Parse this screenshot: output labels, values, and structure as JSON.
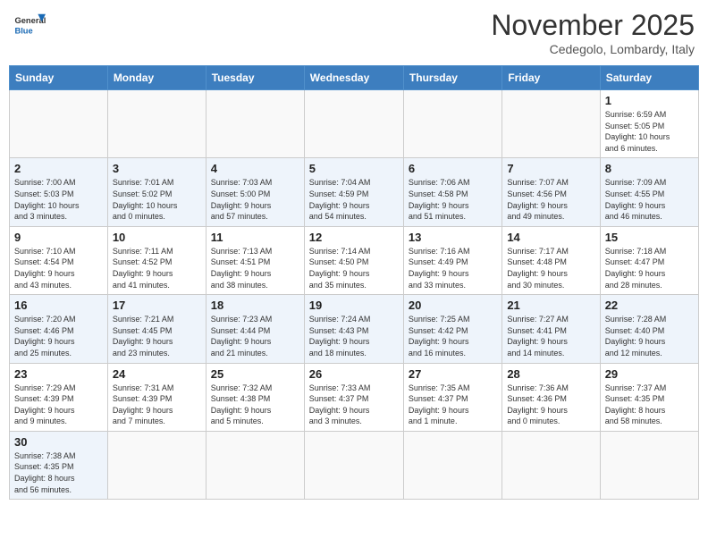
{
  "header": {
    "logo_general": "General",
    "logo_blue": "Blue",
    "month": "November 2025",
    "location": "Cedegolo, Lombardy, Italy"
  },
  "weekdays": [
    "Sunday",
    "Monday",
    "Tuesday",
    "Wednesday",
    "Thursday",
    "Friday",
    "Saturday"
  ],
  "weeks": [
    [
      {
        "day": "",
        "info": ""
      },
      {
        "day": "",
        "info": ""
      },
      {
        "day": "",
        "info": ""
      },
      {
        "day": "",
        "info": ""
      },
      {
        "day": "",
        "info": ""
      },
      {
        "day": "",
        "info": ""
      },
      {
        "day": "1",
        "info": "Sunrise: 6:59 AM\nSunset: 5:05 PM\nDaylight: 10 hours\nand 6 minutes."
      }
    ],
    [
      {
        "day": "2",
        "info": "Sunrise: 7:00 AM\nSunset: 5:03 PM\nDaylight: 10 hours\nand 3 minutes."
      },
      {
        "day": "3",
        "info": "Sunrise: 7:01 AM\nSunset: 5:02 PM\nDaylight: 10 hours\nand 0 minutes."
      },
      {
        "day": "4",
        "info": "Sunrise: 7:03 AM\nSunset: 5:00 PM\nDaylight: 9 hours\nand 57 minutes."
      },
      {
        "day": "5",
        "info": "Sunrise: 7:04 AM\nSunset: 4:59 PM\nDaylight: 9 hours\nand 54 minutes."
      },
      {
        "day": "6",
        "info": "Sunrise: 7:06 AM\nSunset: 4:58 PM\nDaylight: 9 hours\nand 51 minutes."
      },
      {
        "day": "7",
        "info": "Sunrise: 7:07 AM\nSunset: 4:56 PM\nDaylight: 9 hours\nand 49 minutes."
      },
      {
        "day": "8",
        "info": "Sunrise: 7:09 AM\nSunset: 4:55 PM\nDaylight: 9 hours\nand 46 minutes."
      }
    ],
    [
      {
        "day": "9",
        "info": "Sunrise: 7:10 AM\nSunset: 4:54 PM\nDaylight: 9 hours\nand 43 minutes."
      },
      {
        "day": "10",
        "info": "Sunrise: 7:11 AM\nSunset: 4:52 PM\nDaylight: 9 hours\nand 41 minutes."
      },
      {
        "day": "11",
        "info": "Sunrise: 7:13 AM\nSunset: 4:51 PM\nDaylight: 9 hours\nand 38 minutes."
      },
      {
        "day": "12",
        "info": "Sunrise: 7:14 AM\nSunset: 4:50 PM\nDaylight: 9 hours\nand 35 minutes."
      },
      {
        "day": "13",
        "info": "Sunrise: 7:16 AM\nSunset: 4:49 PM\nDaylight: 9 hours\nand 33 minutes."
      },
      {
        "day": "14",
        "info": "Sunrise: 7:17 AM\nSunset: 4:48 PM\nDaylight: 9 hours\nand 30 minutes."
      },
      {
        "day": "15",
        "info": "Sunrise: 7:18 AM\nSunset: 4:47 PM\nDaylight: 9 hours\nand 28 minutes."
      }
    ],
    [
      {
        "day": "16",
        "info": "Sunrise: 7:20 AM\nSunset: 4:46 PM\nDaylight: 9 hours\nand 25 minutes."
      },
      {
        "day": "17",
        "info": "Sunrise: 7:21 AM\nSunset: 4:45 PM\nDaylight: 9 hours\nand 23 minutes."
      },
      {
        "day": "18",
        "info": "Sunrise: 7:23 AM\nSunset: 4:44 PM\nDaylight: 9 hours\nand 21 minutes."
      },
      {
        "day": "19",
        "info": "Sunrise: 7:24 AM\nSunset: 4:43 PM\nDaylight: 9 hours\nand 18 minutes."
      },
      {
        "day": "20",
        "info": "Sunrise: 7:25 AM\nSunset: 4:42 PM\nDaylight: 9 hours\nand 16 minutes."
      },
      {
        "day": "21",
        "info": "Sunrise: 7:27 AM\nSunset: 4:41 PM\nDaylight: 9 hours\nand 14 minutes."
      },
      {
        "day": "22",
        "info": "Sunrise: 7:28 AM\nSunset: 4:40 PM\nDaylight: 9 hours\nand 12 minutes."
      }
    ],
    [
      {
        "day": "23",
        "info": "Sunrise: 7:29 AM\nSunset: 4:39 PM\nDaylight: 9 hours\nand 9 minutes."
      },
      {
        "day": "24",
        "info": "Sunrise: 7:31 AM\nSunset: 4:39 PM\nDaylight: 9 hours\nand 7 minutes."
      },
      {
        "day": "25",
        "info": "Sunrise: 7:32 AM\nSunset: 4:38 PM\nDaylight: 9 hours\nand 5 minutes."
      },
      {
        "day": "26",
        "info": "Sunrise: 7:33 AM\nSunset: 4:37 PM\nDaylight: 9 hours\nand 3 minutes."
      },
      {
        "day": "27",
        "info": "Sunrise: 7:35 AM\nSunset: 4:37 PM\nDaylight: 9 hours\nand 1 minute."
      },
      {
        "day": "28",
        "info": "Sunrise: 7:36 AM\nSunset: 4:36 PM\nDaylight: 9 hours\nand 0 minutes."
      },
      {
        "day": "29",
        "info": "Sunrise: 7:37 AM\nSunset: 4:35 PM\nDaylight: 8 hours\nand 58 minutes."
      }
    ],
    [
      {
        "day": "30",
        "info": "Sunrise: 7:38 AM\nSunset: 4:35 PM\nDaylight: 8 hours\nand 56 minutes."
      },
      {
        "day": "",
        "info": ""
      },
      {
        "day": "",
        "info": ""
      },
      {
        "day": "",
        "info": ""
      },
      {
        "day": "",
        "info": ""
      },
      {
        "day": "",
        "info": ""
      },
      {
        "day": "",
        "info": ""
      }
    ]
  ]
}
